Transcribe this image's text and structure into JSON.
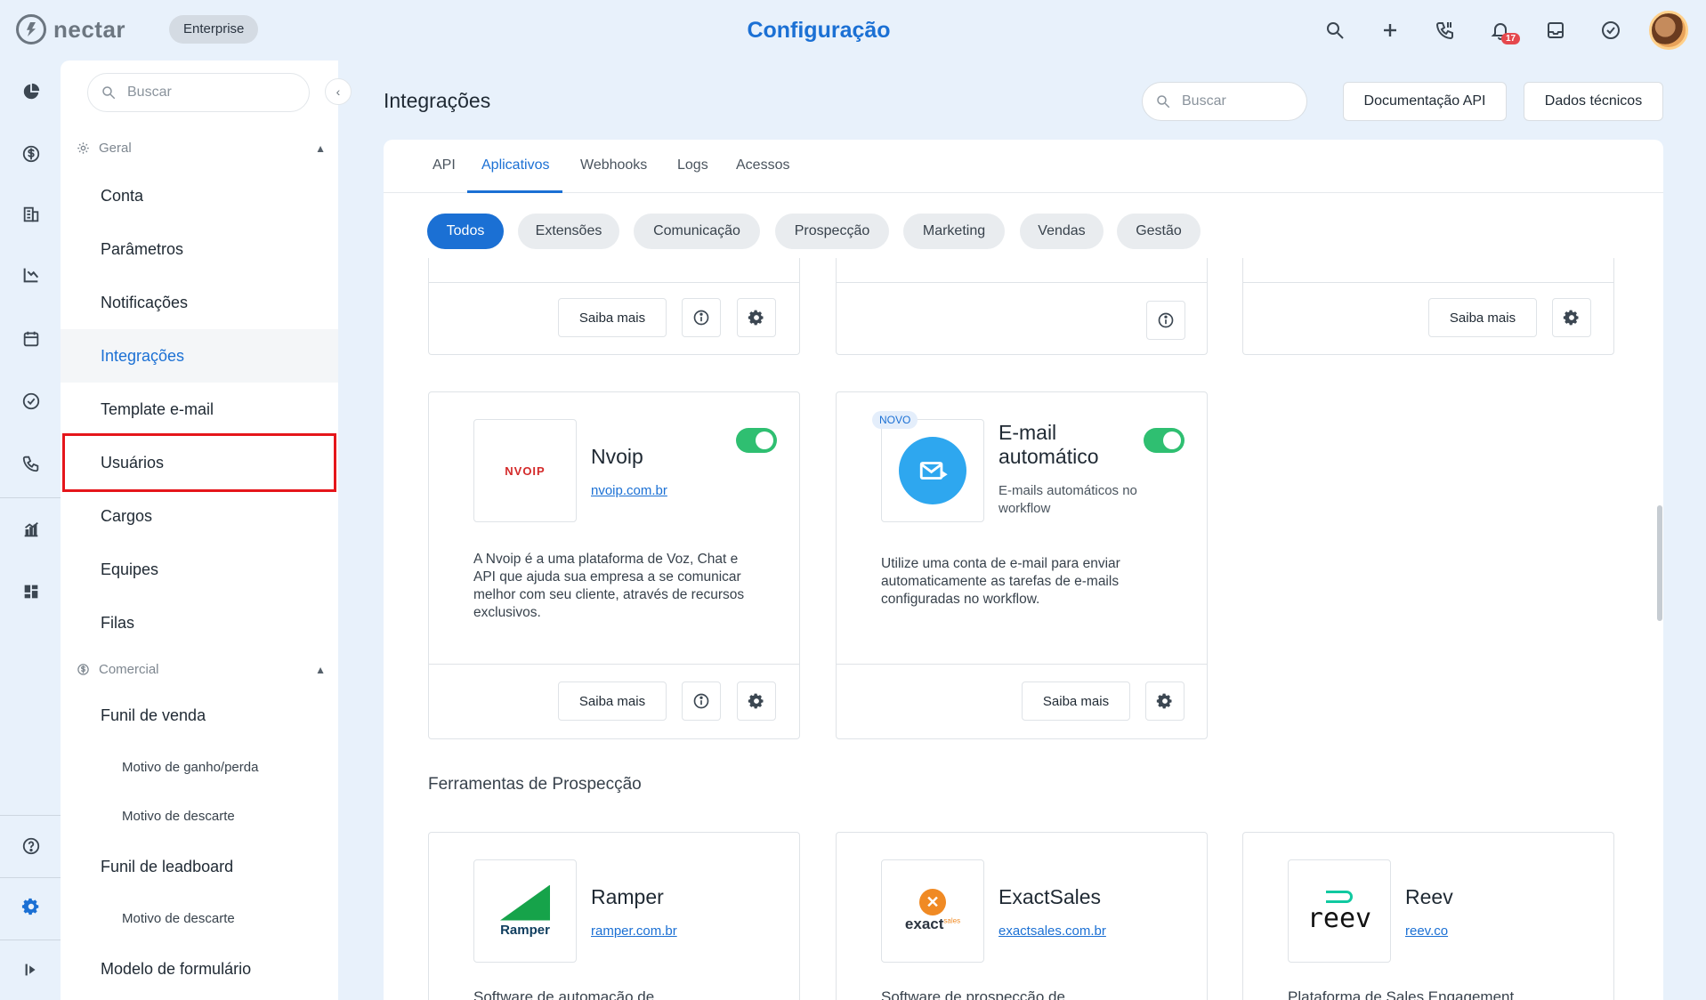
{
  "topbar": {
    "logo_text": "nectar",
    "plan_badge": "Enterprise",
    "title": "Configuração",
    "notification_count": "17",
    "icons": [
      "search-icon",
      "plus-icon",
      "phone-icon",
      "bell-icon",
      "inbox-icon",
      "check-circle-icon",
      "avatar"
    ]
  },
  "rail": {
    "icons": [
      "pie-chart-icon",
      "dollar-icon",
      "building-icon",
      "funnel-chart-icon",
      "calendar-icon",
      "check-circle-icon",
      "phone-icon",
      "analytics-icon",
      "dashboard-icon",
      "help-icon",
      "settings-icon",
      "expand-icon"
    ]
  },
  "nav": {
    "search_placeholder": "Buscar",
    "section_geral": "Geral",
    "section_comercial": "Comercial",
    "items": {
      "conta": "Conta",
      "parametros": "Parâmetros",
      "notificacoes": "Notificações",
      "integracoes": "Integrações",
      "template_email": "Template e-mail",
      "usuarios": "Usuários",
      "cargos": "Cargos",
      "equipes": "Equipes",
      "filas": "Filas",
      "funil_venda": "Funil de venda",
      "motivo_ganho": "Motivo de ganho/perda",
      "motivo_descarte_1": "Motivo de descarte",
      "funil_leadboard": "Funil de leadboard",
      "motivo_descarte_2": "Motivo de descarte",
      "modelo_formulario": "Modelo de formulário"
    }
  },
  "main": {
    "title": "Integrações",
    "search_placeholder": "Buscar",
    "doc_api_button": "Documentação API",
    "tech_data_button": "Dados técnicos",
    "tabs": [
      "API",
      "Aplicativos",
      "Webhooks",
      "Logs",
      "Acessos"
    ],
    "active_tab": "Aplicativos",
    "filters": [
      "Todos",
      "Extensões",
      "Comunicação",
      "Prospecção",
      "Marketing",
      "Vendas",
      "Gestão"
    ],
    "active_filter": "Todos",
    "saiba_mais": "Saiba mais",
    "new_badge": "NOVO",
    "cards": {
      "nvoip": {
        "name": "Nvoip",
        "link": "nvoip.com.br",
        "logo_text": "NVOIP",
        "description": "A Nvoip é a uma plataforma de Voz, Chat e API que ajuda sua empresa a se comunicar melhor com seu cliente, através de recursos exclusivos.",
        "enabled": true
      },
      "email_auto": {
        "name": "E-mail automático",
        "subtitle": "E-mails automáticos no workflow",
        "description": "Utilize uma conta de e-mail para enviar automaticamente as tarefas de e-mails configuradas no workflow.",
        "enabled": true
      },
      "ramper": {
        "name": "Ramper",
        "link": "ramper.com.br",
        "logo_text": "Ramper",
        "description": "Software de automação de"
      },
      "exactsales": {
        "name": "ExactSales",
        "link": "exactsales.com.br",
        "logo_text": "exact",
        "logo_sup": "sales",
        "description": "Software de prospecção de"
      },
      "reev": {
        "name": "Reev",
        "link": "reev.co",
        "logo_text": "reev",
        "description": "Plataforma de Sales Engagement"
      }
    },
    "section_prospeccao": "Ferramentas de Prospecção"
  },
  "colors": {
    "accent": "#1b70d4",
    "toggle_on": "#2fbf71",
    "highlight": "#e5161b",
    "background": "#e8f1fb"
  }
}
